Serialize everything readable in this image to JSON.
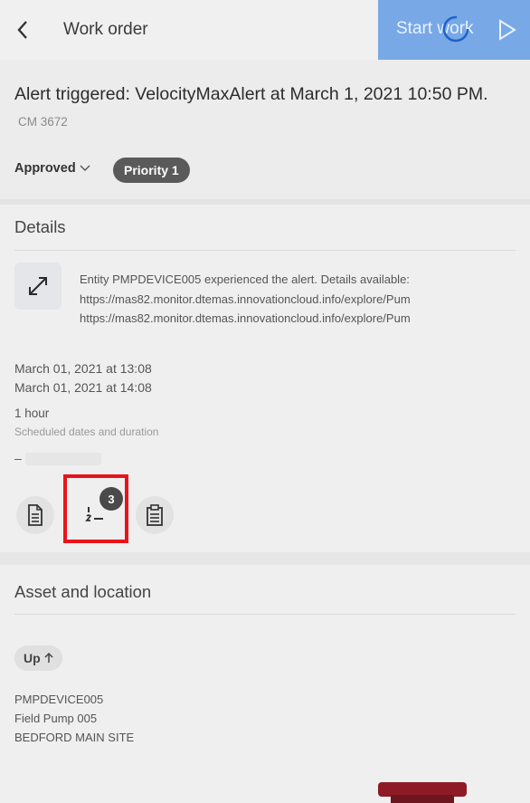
{
  "header": {
    "title": "Work order",
    "start_button": "Start work"
  },
  "workorder": {
    "title": "Alert triggered: VelocityMaxAlert at March 1, 2021 10:50 PM.",
    "number": "CM 3672",
    "status": "Approved",
    "priority": "Priority 1"
  },
  "details": {
    "heading": "Details",
    "description_lines": [
      "Entity PMPDEVICE005 experienced the alert. Details available:",
      "https://mas82.monitor.dtemas.innovationcloud.info/explore/Pum",
      "https://mas82.monitor.dtemas.innovationcloud.info/explore/Pum"
    ],
    "start_date": "March 01, 2021  at  13:08",
    "end_date": "March 01, 2021  at  14:08",
    "duration": "1 hour",
    "duration_label": "Scheduled dates and duration",
    "empty_value": "–",
    "tasks_badge": "3"
  },
  "asset": {
    "heading": "Asset and location",
    "status": "Up",
    "asset_id": "PMPDEVICE005",
    "asset_name": "Field Pump 005",
    "site": "BEDFORD MAIN SITE"
  },
  "colors": {
    "accent": "#78a8e6",
    "highlight": "#e8141b",
    "badge": "#4a4a4a"
  }
}
